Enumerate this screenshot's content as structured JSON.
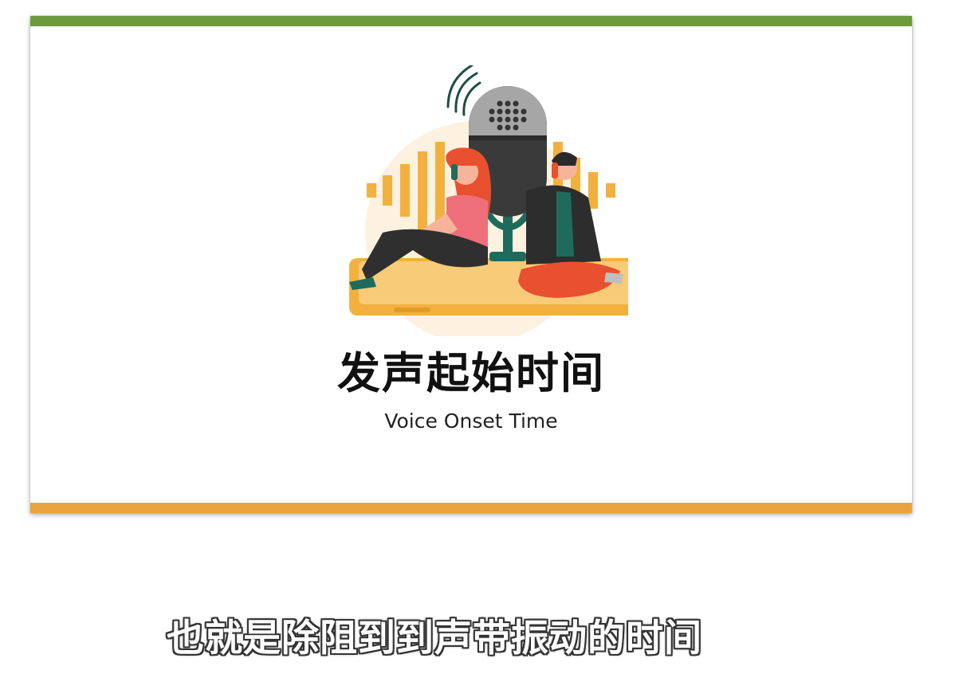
{
  "slide": {
    "title_cn": "发声起始时间",
    "title_en": "Voice Onset Time"
  },
  "caption": {
    "text": "也就是除阻到到声带振动的时间"
  },
  "colors": {
    "top_bar": "#6e9a3e",
    "bottom_bar": "#eba33f",
    "orange": "#f2b13e",
    "mic_gray": "#8c8c8c",
    "mic_dark": "#3a3a3a",
    "teal": "#1e6b5c",
    "red_hair": "#e8502f",
    "pink_top": "#ee6f7a"
  },
  "icons": {
    "illustration": "podcast-microphone-illustration"
  }
}
